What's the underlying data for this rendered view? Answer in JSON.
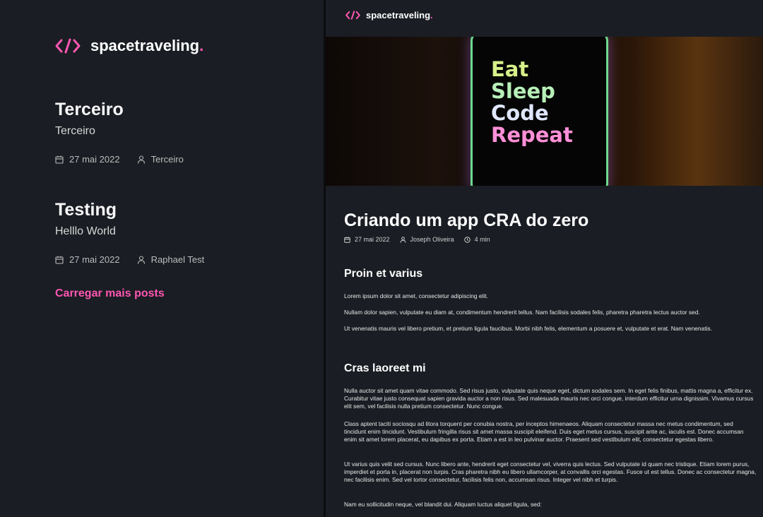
{
  "brand": {
    "name": "spacetraveling",
    "dot": ".",
    "accent": "#ff57b2"
  },
  "posts": [
    {
      "title": "Terceiro",
      "subtitle": "Terceiro",
      "date": "27 mai 2022",
      "author": "Terceiro"
    },
    {
      "title": "Testing",
      "subtitle": "Helllo World",
      "date": "27 mai 2022",
      "author": "Raphael Test"
    }
  ],
  "load_more_label": "Carregar mais posts",
  "article": {
    "banner_words": [
      "Eat",
      "Sleep",
      "Code",
      "Repeat"
    ],
    "title": "Criando um app CRA do zero",
    "date": "27 mai 2022",
    "author": "Joseph Oliveira",
    "reading_time": "4 min",
    "sections": [
      {
        "heading": "Proin et varius",
        "paragraphs": [
          "Lorem ipsum dolor sit amet, consectetur adipiscing elit.",
          "Nullam dolor sapien, vulputate eu diam at, condimentum hendrerit tellus. Nam facilisis sodales felis, pharetra pharetra lectus auctor sed.",
          "Ut venenatis mauris vel libero pretium, et pretium ligula faucibus. Morbi nibh felis, elementum a posuere et, vulputate et erat. Nam venenatis."
        ]
      },
      {
        "heading": "Cras laoreet mi",
        "paragraphs": [
          "Nulla auctor sit amet quam vitae commodo. Sed risus justo, vulputate quis neque eget, dictum sodales sem. In eget felis finibus, mattis magna a, efficitur ex. Curabitur vitae justo consequat sapien gravida auctor a non risus. Sed malesuada mauris nec orci congue, interdum efficitur urna dignissim. Vivamus cursus elit sem, vel facilisis nulla pretium consectetur. Nunc congue.",
          "Class aptent taciti sociosqu ad litora torquent per conubia nostra, per inceptos himenaeos. Aliquam consectetur massa nec metus condimentum, sed tincidunt enim tincidunt. Vestibulum fringilla risus sit amet massa suscipit eleifend. Duis eget metus cursus, suscipit ante ac, iaculis est. Donec accumsan enim sit amet lorem placerat, eu dapibus ex porta. Etiam a est in leo pulvinar auctor. Praesent sed vestibulum elit, consectetur egestas libero.",
          "Ut varius quis velit sed cursus. Nunc libero ante, hendrerit eget consectetur vel, viverra quis lectus. Sed vulputate id quam nec tristique. Etiam lorem purus, imperdiet et porta in, placerat non turpis. Cras pharetra nibh eu libero ullamcorper, at convallis orci egestas. Fusce ut est tellus. Donec ac consectetur magna, nec facilisis enim. Sed vel tortor consectetur, facilisis felis non, accumsan risus. Integer vel nibh et turpis.",
          "Nam eu sollicitudin neque, vel blandit dui. Aliquam luctus aliquet ligula, sed:"
        ]
      }
    ]
  }
}
